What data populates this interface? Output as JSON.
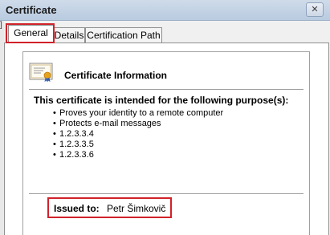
{
  "window": {
    "title": "Certificate",
    "close_glyph": "✕",
    "left_marker": "]"
  },
  "tabs": [
    {
      "label": "General",
      "selected": true
    },
    {
      "label": "Details",
      "selected": false
    },
    {
      "label": "Certification Path",
      "selected": false
    }
  ],
  "info": {
    "icon": "certificate-icon",
    "heading": "Certificate Information",
    "purpose_heading": "This certificate is intended for the following purpose(s):",
    "purposes": [
      "Proves your identity to a remote computer",
      "Protects e-mail messages",
      "1.2.3.3.4",
      "1.2.3.3.5",
      "1.2.3.3.6"
    ],
    "bullet": "•"
  },
  "issued": {
    "label": "Issued to:",
    "value": "Petr Šimkovič"
  },
  "colors": {
    "highlight": "#d1222a",
    "title_bar": "#cfdbe9"
  }
}
